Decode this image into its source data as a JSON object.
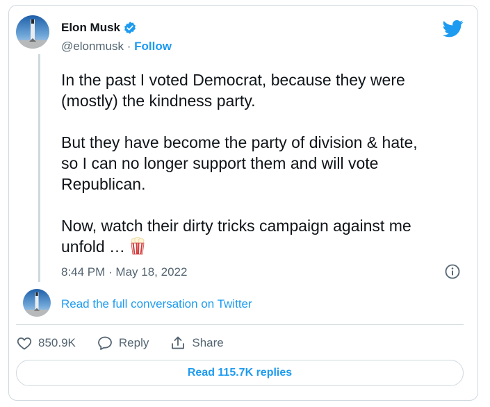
{
  "author": {
    "name": "Elon Musk",
    "handle": "@elonmusk",
    "separator": "·",
    "follow_label": "Follow",
    "verified": true
  },
  "tweet": {
    "text": "In the past I voted Democrat, because they were\n(mostly) the kindness party.\n\nBut they have become the party of division & hate,\nso I can no longer support them and will vote\nRepublican.\n\nNow, watch their dirty tricks campaign against me\nunfold … ",
    "emoji_icon": "popcorn-icon",
    "timestamp": "8:44 PM · May 18, 2022"
  },
  "conversation_link": "Read the full conversation on Twitter",
  "actions": {
    "likes": "850.9K",
    "reply_label": "Reply",
    "share_label": "Share"
  },
  "read_replies_label": "Read 115.7K replies",
  "colors": {
    "accent": "#1d9bf0",
    "text": "#0f1419",
    "muted": "#536471",
    "border": "#cfd9de"
  }
}
